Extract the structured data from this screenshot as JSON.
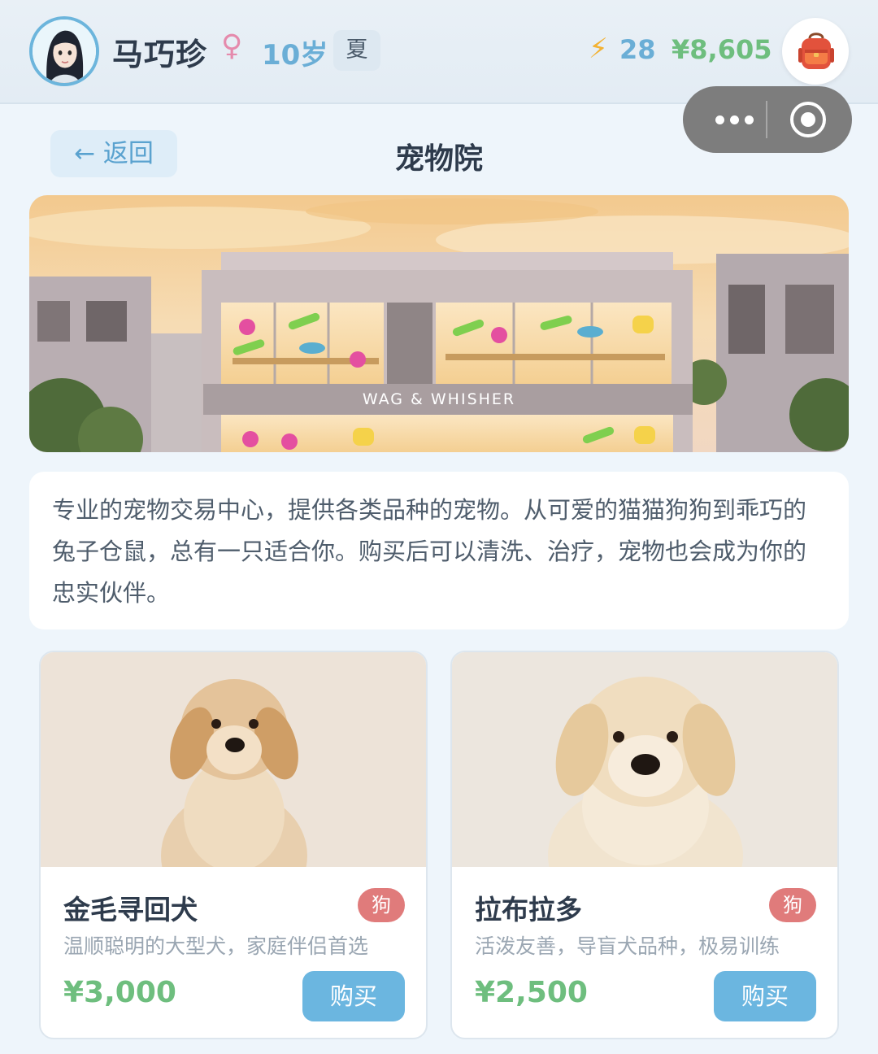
{
  "player": {
    "name": "马巧珍",
    "gender_symbol": "♀",
    "age": "10岁",
    "season": "夏",
    "energy_symbol": "⚡",
    "energy": "28",
    "money": "¥8,605"
  },
  "header": {
    "back_label": "← 返回",
    "title": "宠物院"
  },
  "banner": {
    "store_sign": "WAG & WHISHER"
  },
  "description": "专业的宠物交易中心，提供各类品种的宠物。从可爱的猫猫狗狗到乖巧的兔子仓鼠，总有一只适合你。购买后可以清洗、治疗，宠物也会成为你的忠实伙伴。",
  "pets": [
    {
      "name": "金毛寻回犬",
      "type": "狗",
      "desc": "温顺聪明的大型犬，家庭伴侣首选",
      "price": "¥3,000",
      "buy_label": "购买"
    },
    {
      "name": "拉布拉多",
      "type": "狗",
      "desc": "活泼友善，导盲犬品种，极易训练",
      "price": "¥2,500",
      "buy_label": "购买"
    }
  ],
  "icons": {
    "gender": "female-icon",
    "energy": "lightning-icon",
    "backpack": "backpack-icon",
    "capsule_more": "more-dots-icon",
    "capsule_close": "close-circle-icon"
  },
  "colors": {
    "accent_blue": "#6bb6e0",
    "money_green": "#6ebe7e",
    "type_badge_red": "#e07b7b",
    "energy_yellow": "#f3b233",
    "gender_pink": "#e58aac"
  }
}
